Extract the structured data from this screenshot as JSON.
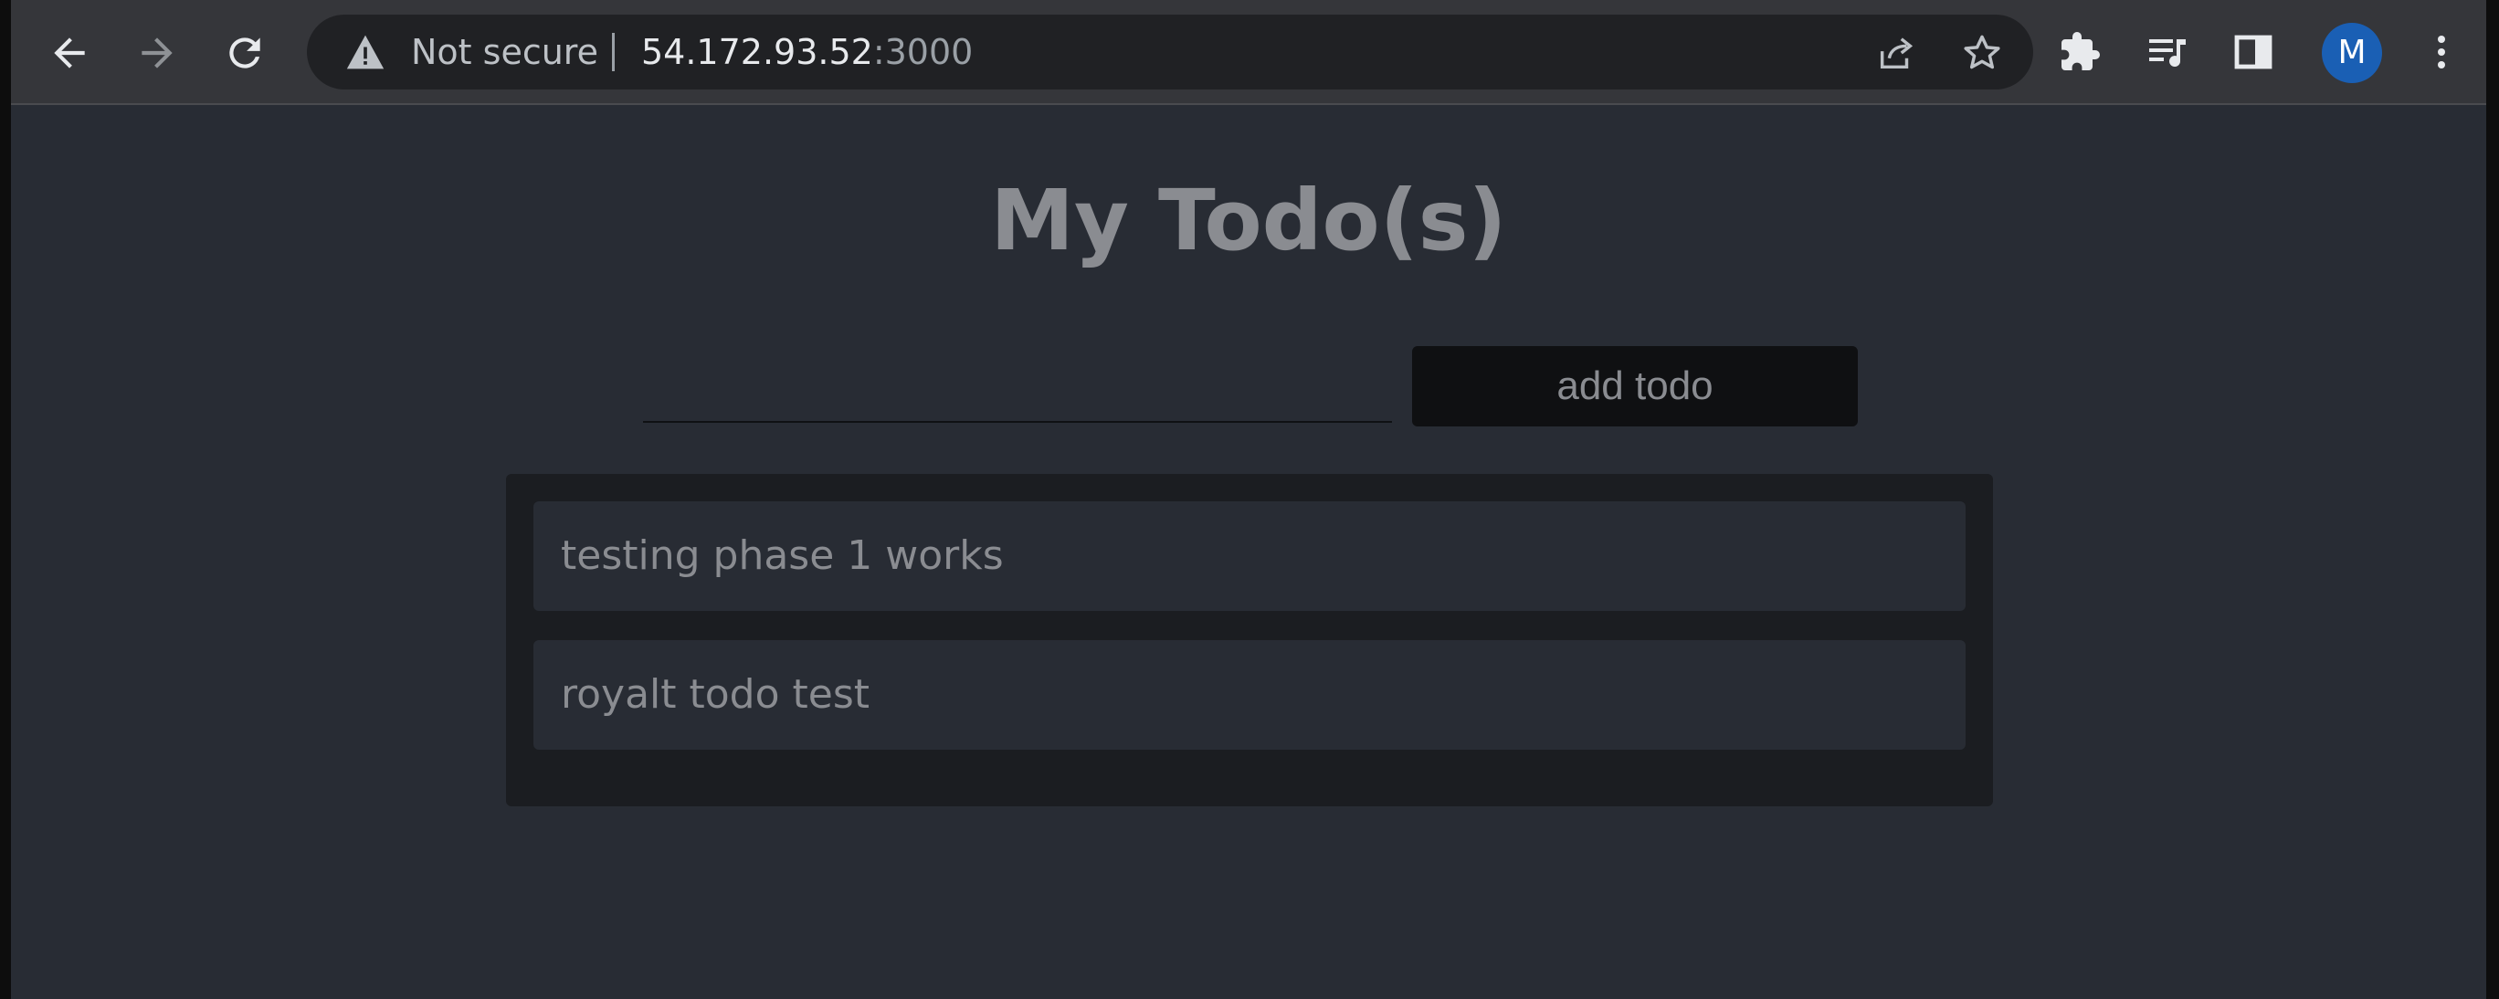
{
  "browser": {
    "security_label": "Not secure",
    "url_host": "54.172.93.52",
    "url_port": ":3000",
    "profile_initial": "M",
    "profile_color": "#1a5fb4",
    "icons": {
      "back": "arrow-left-icon",
      "forward": "arrow-right-icon",
      "reload": "reload-icon",
      "warning": "warning-triangle-icon",
      "share": "share-icon",
      "bookmark": "star-icon",
      "extensions": "puzzle-icon",
      "media": "media-queue-icon",
      "side_panel": "side-panel-icon",
      "menu": "kebab-menu-icon"
    }
  },
  "app": {
    "title": "My Todo(s)",
    "input": {
      "value": "",
      "placeholder": ""
    },
    "add_button_label": "add todo",
    "todos": [
      {
        "text": "testing phase 1 works"
      },
      {
        "text": "royalt todo test"
      }
    ]
  }
}
